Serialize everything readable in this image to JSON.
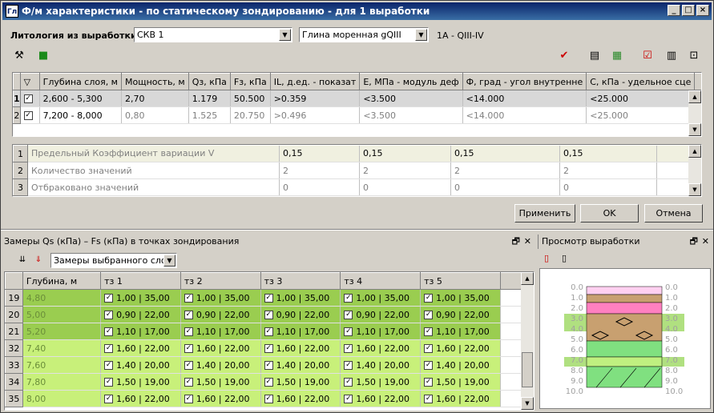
{
  "window": {
    "title": "Ф/м характеристики - по статическому зондированию - для 1 выработки",
    "icon": "Гл",
    "buttons": [
      "minimize",
      "maximize",
      "close"
    ]
  },
  "lithology": {
    "label": "Литология из выработки:",
    "well_value": "СКВ 1",
    "layer_value": "Глина моренная gQIII",
    "index_text": "1А - QIII-IV"
  },
  "toolbar_icons": [
    "hammer-icon",
    "save-icon",
    "check-list-icon",
    "report-icon",
    "table-icon",
    "checkbox-icon",
    "columns-icon",
    "expand-icon"
  ],
  "layers_table": {
    "columns": [
      "",
      "▽",
      "Глубина слоя, м",
      "Мощность, м",
      "Qз, кПа",
      "Fз, кПа",
      "IL, д.ед. - показат",
      "E, МПа - модуль деф",
      "Ф, град - угол внутренне",
      "С, кПа - удельное сце"
    ],
    "rows": [
      {
        "n": "1",
        "checked": "✓",
        "depth": "2,600 - 5,300",
        "thick": "2,70",
        "q": "1.179",
        "f": "50.500",
        "il": ">0.359",
        "e": "<3.500",
        "phi": "<14.000",
        "c": "<25.000"
      },
      {
        "n": "2",
        "checked": "✓",
        "depth": "7,200 - 8,000",
        "thick": "0,80",
        "q": "1.525",
        "f": "20.750",
        "il": ">0.496",
        "e": "<3.500",
        "phi": "<14.000",
        "c": "<25.000"
      }
    ]
  },
  "stats_table": {
    "rows": [
      {
        "n": "1",
        "label": "Предельный Коэффициент вариации V",
        "il": "0,15",
        "e": "0,15",
        "phi": "0,15",
        "c": "0,15"
      },
      {
        "n": "2",
        "label": "Количество значений",
        "il": "2",
        "e": "2",
        "phi": "2",
        "c": "2"
      },
      {
        "n": "3",
        "label": "Отбраковано значений",
        "il": "0",
        "e": "0",
        "phi": "0",
        "c": "0"
      }
    ]
  },
  "actions": {
    "apply": "Применить",
    "ok": "OK",
    "cancel": "Отмена"
  },
  "measures_panel": {
    "title": "Замеры Qs (кПа) – Fs (кПа) в точках зондирования",
    "filter_value": "Замеры выбранного слоя",
    "columns": [
      "",
      "Глубина, м",
      "тз 1",
      "тз 2",
      "тз 3",
      "тз 4",
      "тз 5"
    ],
    "rows": [
      {
        "n": "19",
        "depth": "4,80",
        "tone": "dk",
        "v": [
          "1,00 | 35,00",
          "1,00 | 35,00",
          "1,00 | 35,00",
          "1,00 | 35,00",
          "1,00 | 35,00"
        ]
      },
      {
        "n": "20",
        "depth": "5,00",
        "tone": "dk",
        "v": [
          "0,90 | 22,00",
          "0,90 | 22,00",
          "0,90 | 22,00",
          "0,90 | 22,00",
          "0,90 | 22,00"
        ]
      },
      {
        "n": "21",
        "depth": "5,20",
        "tone": "dk",
        "v": [
          "1,10 | 17,00",
          "1,10 | 17,00",
          "1,10 | 17,00",
          "1,10 | 17,00",
          "1,10 | 17,00"
        ]
      },
      {
        "n": "32",
        "depth": "7,40",
        "tone": "lt",
        "v": [
          "1,60 | 22,00",
          "1,60 | 22,00",
          "1,60 | 22,00",
          "1,60 | 22,00",
          "1,60 | 22,00"
        ]
      },
      {
        "n": "33",
        "depth": "7,60",
        "tone": "lt",
        "v": [
          "1,40 | 20,00",
          "1,40 | 20,00",
          "1,40 | 20,00",
          "1,40 | 20,00",
          "1,40 | 20,00"
        ]
      },
      {
        "n": "34",
        "depth": "7,80",
        "tone": "lt",
        "v": [
          "1,50 | 19,00",
          "1,50 | 19,00",
          "1,50 | 19,00",
          "1,50 | 19,00",
          "1,50 | 19,00"
        ]
      },
      {
        "n": "35",
        "depth": "8,00",
        "tone": "lt",
        "v": [
          "1,60 | 22,00",
          "1,60 | 22,00",
          "1,60 | 22,00",
          "1,60 | 22,00",
          "1,60 | 22,00"
        ]
      }
    ]
  },
  "preview_panel": {
    "title": "Просмотр выработки",
    "scale": [
      "0.0",
      "1.0",
      "2.0",
      "3.0",
      "4.0",
      "5.0",
      "6.0",
      "7.0",
      "8.0",
      "9.0",
      "10.0"
    ],
    "colors": {
      "pink": "#ff80c0",
      "tan": "#c8a070",
      "green": "#80e080",
      "lightgreen": "#c0f080",
      "highlight": "#b0e080"
    }
  }
}
